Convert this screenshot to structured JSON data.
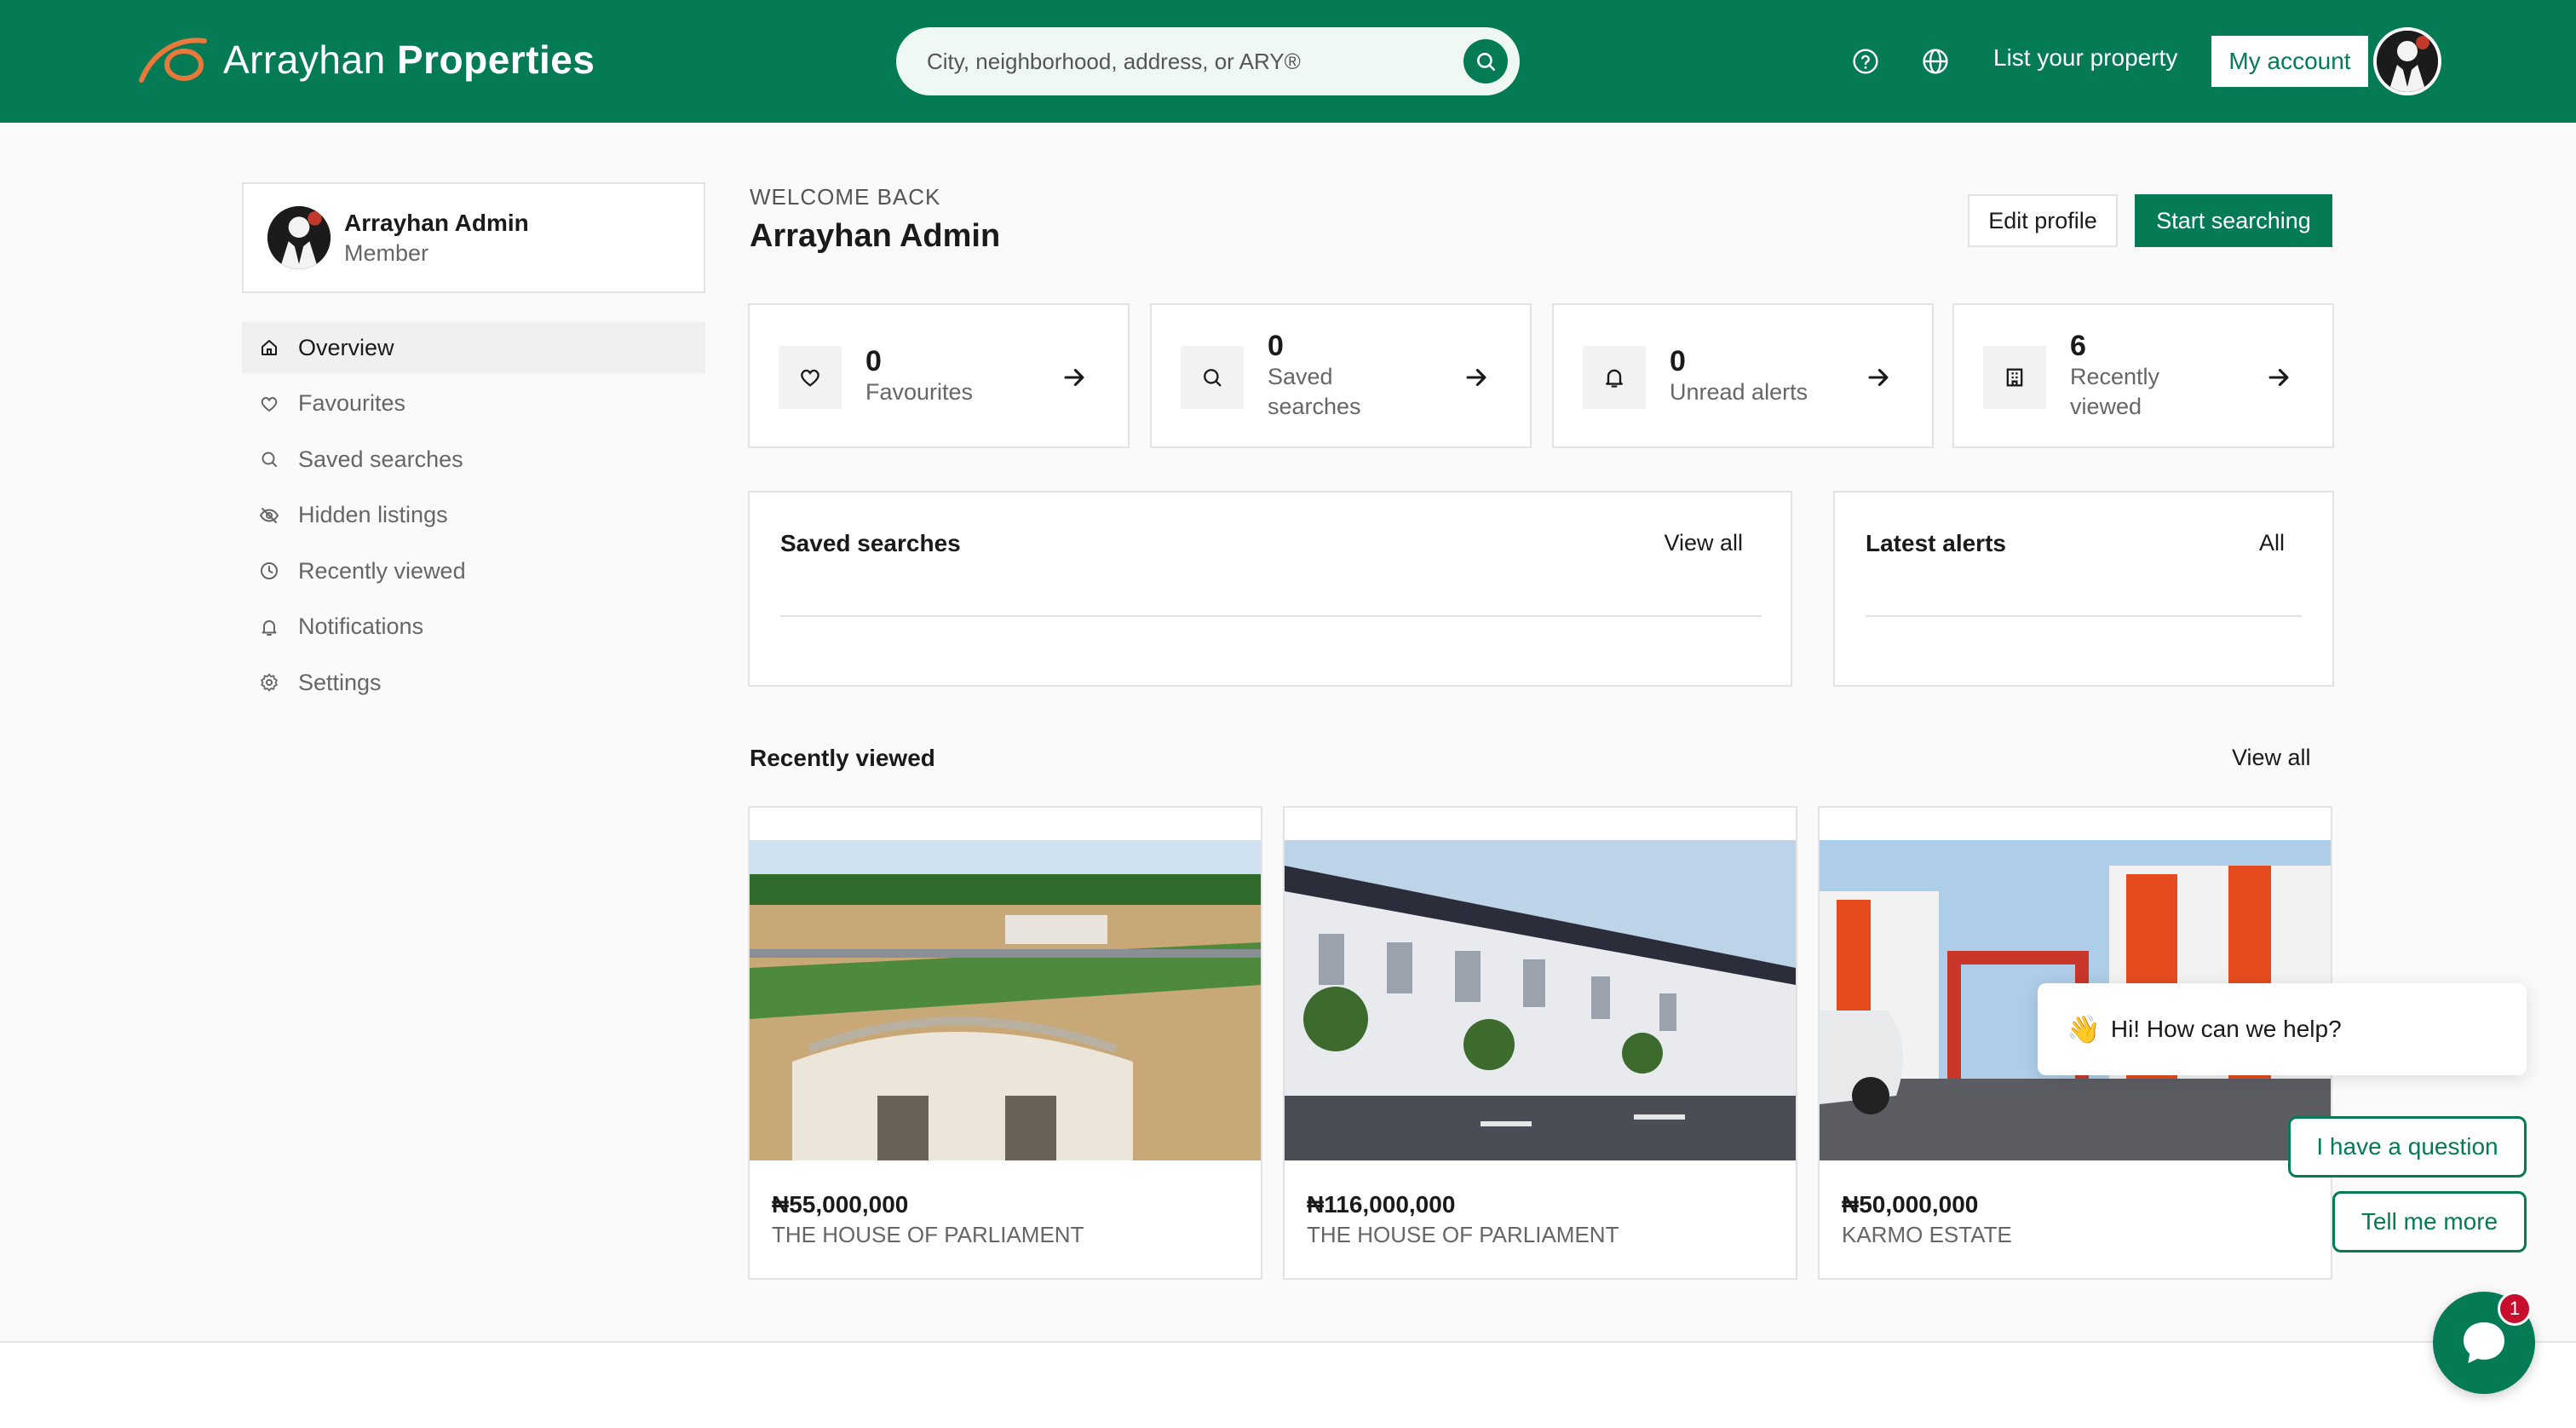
{
  "header": {
    "brand_light": "Arrayhan",
    "brand_bold": "Properties",
    "search_placeholder": "City, neighborhood, address, or ARY®",
    "list_property": "List your property",
    "my_account": "My account"
  },
  "profile": {
    "name": "Arrayhan Admin",
    "role": "Member"
  },
  "sidebar": {
    "items": [
      {
        "label": "Overview",
        "icon": "home-icon",
        "active": true
      },
      {
        "label": "Favourites",
        "icon": "heart-icon"
      },
      {
        "label": "Saved searches",
        "icon": "search-icon"
      },
      {
        "label": "Hidden listings",
        "icon": "eye-off-icon"
      },
      {
        "label": "Recently viewed",
        "icon": "clock-icon"
      },
      {
        "label": "Notifications",
        "icon": "bell-icon"
      },
      {
        "label": "Settings",
        "icon": "gear-icon"
      }
    ]
  },
  "welcome": {
    "label": "WELCOME BACK",
    "name": "Arrayhan Admin",
    "edit_profile": "Edit profile",
    "start_searching": "Start searching"
  },
  "stats": [
    {
      "value": "0",
      "label": "Favourites",
      "icon": "heart-icon"
    },
    {
      "value": "0",
      "label": "Saved searches",
      "icon": "search-icon"
    },
    {
      "value": "0",
      "label": "Unread alerts",
      "icon": "bell-icon"
    },
    {
      "value": "6",
      "label": "Recently viewed",
      "icon": "building-icon"
    }
  ],
  "panels": {
    "saved_searches": {
      "title": "Saved searches",
      "link": "View all"
    },
    "latest_alerts": {
      "title": "Latest alerts",
      "link": "All"
    }
  },
  "recently_viewed": {
    "title": "Recently viewed",
    "view_all": "View all",
    "items": [
      {
        "price": "₦55,000,000",
        "name": "THE HOUSE OF PARLIAMENT"
      },
      {
        "price": "₦116,000,000",
        "name": "THE HOUSE OF PARLIAMENT"
      },
      {
        "price": "₦50,000,000",
        "name": "KARMO ESTATE"
      }
    ]
  },
  "chat": {
    "wave": "👋",
    "greeting": "Hi! How can we help?",
    "option_1": "I have a question",
    "option_2": "Tell me more",
    "badge": "1"
  },
  "colors": {
    "brand_green": "#047a55",
    "logo_orange": "#e8793a",
    "badge_red": "#c8102e"
  }
}
